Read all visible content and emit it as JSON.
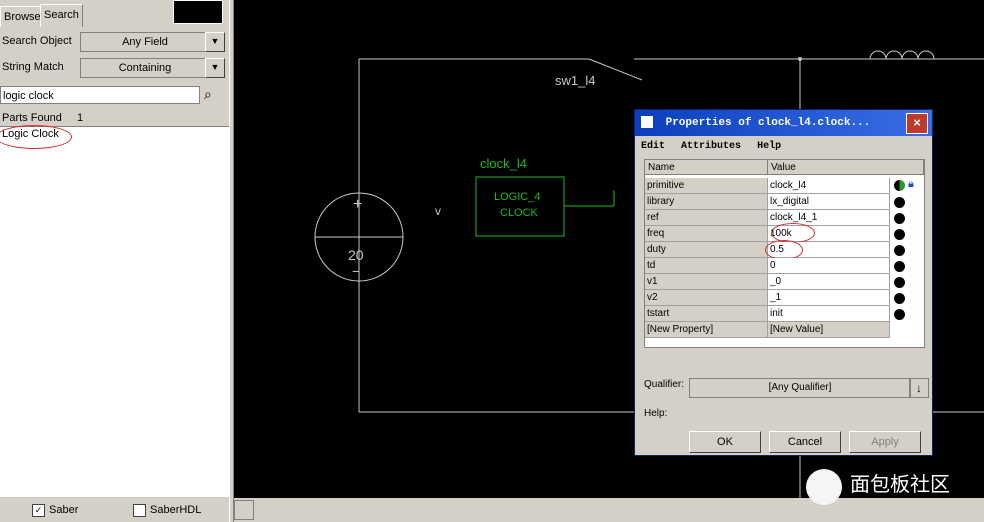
{
  "left_panel": {
    "tabs": [
      "Browse",
      "Search"
    ],
    "search_object_label": "Search Object",
    "search_object_value": "Any Field",
    "string_match_label": "String Match",
    "string_match_value": "Containing",
    "search_value": "logic clock",
    "parts_found_label": "Parts Found",
    "parts_found_count": "1",
    "results": [
      "Logic Clock"
    ],
    "saber_label": "Saber",
    "saberhdl_label": "SaberHDL"
  },
  "schematic": {
    "switch_label": "sw1_l4",
    "clock_instance": "clock_l4",
    "clock_text_1": "LOGIC_4",
    "clock_text_2": "CLOCK",
    "source_plus": "+",
    "source_value": "20",
    "source_minus": "−",
    "node_label": "v"
  },
  "dialog": {
    "title": "Properties of clock_l4.clock...",
    "close": "×",
    "menu": [
      "Edit",
      "Attributes",
      "Help"
    ],
    "col_name": "Name",
    "col_value": "Value",
    "rows": [
      {
        "name": "primitive",
        "value": "clock_l4"
      },
      {
        "name": "library",
        "value": "lx_digital"
      },
      {
        "name": "ref",
        "value": "clock_l4_1"
      },
      {
        "name": "freq",
        "value": "100k"
      },
      {
        "name": "duty",
        "value": "0.5"
      },
      {
        "name": "td",
        "value": "0"
      },
      {
        "name": "v1",
        "value": "_0"
      },
      {
        "name": "v2",
        "value": "_1"
      },
      {
        "name": "tstart",
        "value": "init"
      },
      {
        "name": "[New Property]",
        "value": "[New Value]"
      }
    ],
    "qualifier_label": "Qualifier:",
    "qualifier_value": "[Any Qualifier]",
    "help_label": "Help:",
    "ok": "OK",
    "cancel": "Cancel",
    "apply": "Apply"
  },
  "watermark": "面包板社区",
  "colors": {
    "schematic_line": "#c8c8c8",
    "component_green": "#22b822",
    "title_bar": "#0a3fbd",
    "annotation_red": "#d03030"
  }
}
